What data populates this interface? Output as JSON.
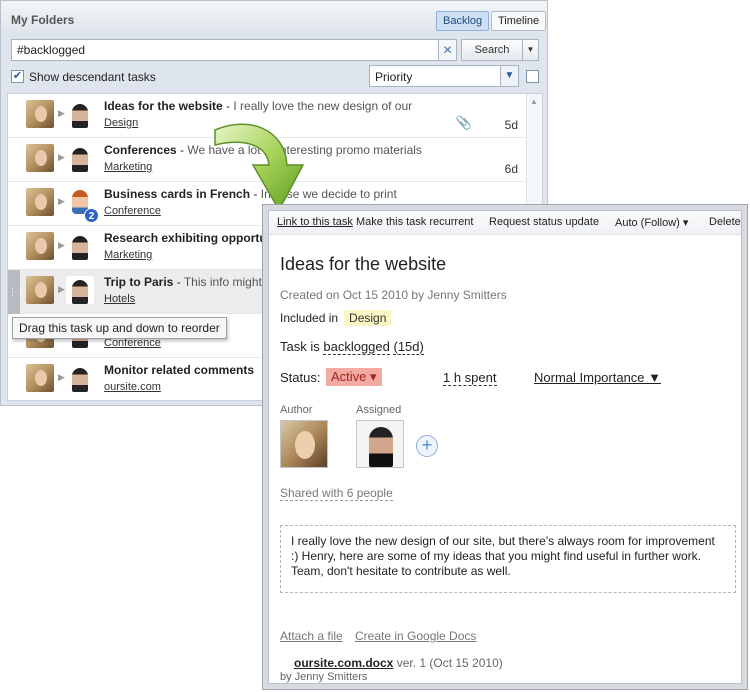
{
  "folders": {
    "title": "My Folders",
    "view_buttons": {
      "backlog": "Backlog",
      "timeline": "Timeline"
    },
    "search": {
      "value": "#backlogged",
      "clear": "✕",
      "button": "Search"
    },
    "show_descendant_label": "Show descendant tasks",
    "sort_value": "Priority",
    "tasks": [
      {
        "title": "Ideas for the website",
        "snippet": "I really love the new design of our",
        "folder": "Design",
        "age": "5d"
      },
      {
        "title": "Conferences",
        "snippet": "We have a lot of interesting promo materials",
        "folder": "Marketing",
        "age": "6d"
      },
      {
        "title": "Business cards in French",
        "snippet": "In case we decide to print",
        "folder": "Conference",
        "badge": "2"
      },
      {
        "title": "Research exhibiting opportu",
        "snippet": "",
        "folder": "Marketing"
      },
      {
        "title": "Trip to Paris",
        "snippet": "This info might",
        "folder": "Hotels"
      },
      {
        "title": "",
        "snippet": "",
        "folder": "Conference"
      },
      {
        "title": "Monitor related comments",
        "snippet": "",
        "folder": "oursite.com"
      }
    ],
    "tooltip": "Drag this task up and down to reorder"
  },
  "detail": {
    "toolbar": {
      "link": "Link to this task",
      "recurrent": "Make this task recurrent",
      "status_update": "Request status update",
      "follow": "Auto (Follow) ▾",
      "delete": "Delete"
    },
    "title": "Ideas for the website",
    "created": "Created on Oct 15 2010 by Jenny Smitters",
    "included_label": "Included in",
    "included_folder": "Design",
    "task_is_prefix": "Task is",
    "task_state": "backlogged",
    "task_age": "(15d)",
    "status_label": "Status:",
    "status_value": "Active ▾",
    "time_spent": "1 h spent",
    "importance": "Normal Importance ▼",
    "author_label": "Author",
    "assigned_label": "Assigned",
    "shared_with": "Shared with 6 people",
    "description": "I really love the new design of our site, but there's always room for improvement :) Henry, here are some of my ideas that you might find useful in further work. Team, don't hesitate to contribute as well.",
    "attach_file": "Attach a file",
    "create_gdocs": "Create in Google Docs",
    "file": {
      "name": "oursite.com.docx",
      "version": "ver. 1 (Oct 15 2010)",
      "author": "by Jenny Smitters"
    }
  },
  "colors": {
    "accent": "#2e62c4",
    "status_bg": "#f2aaa3",
    "folder_highlight": "#fbf6c6",
    "arrow": "#7ab32e"
  }
}
